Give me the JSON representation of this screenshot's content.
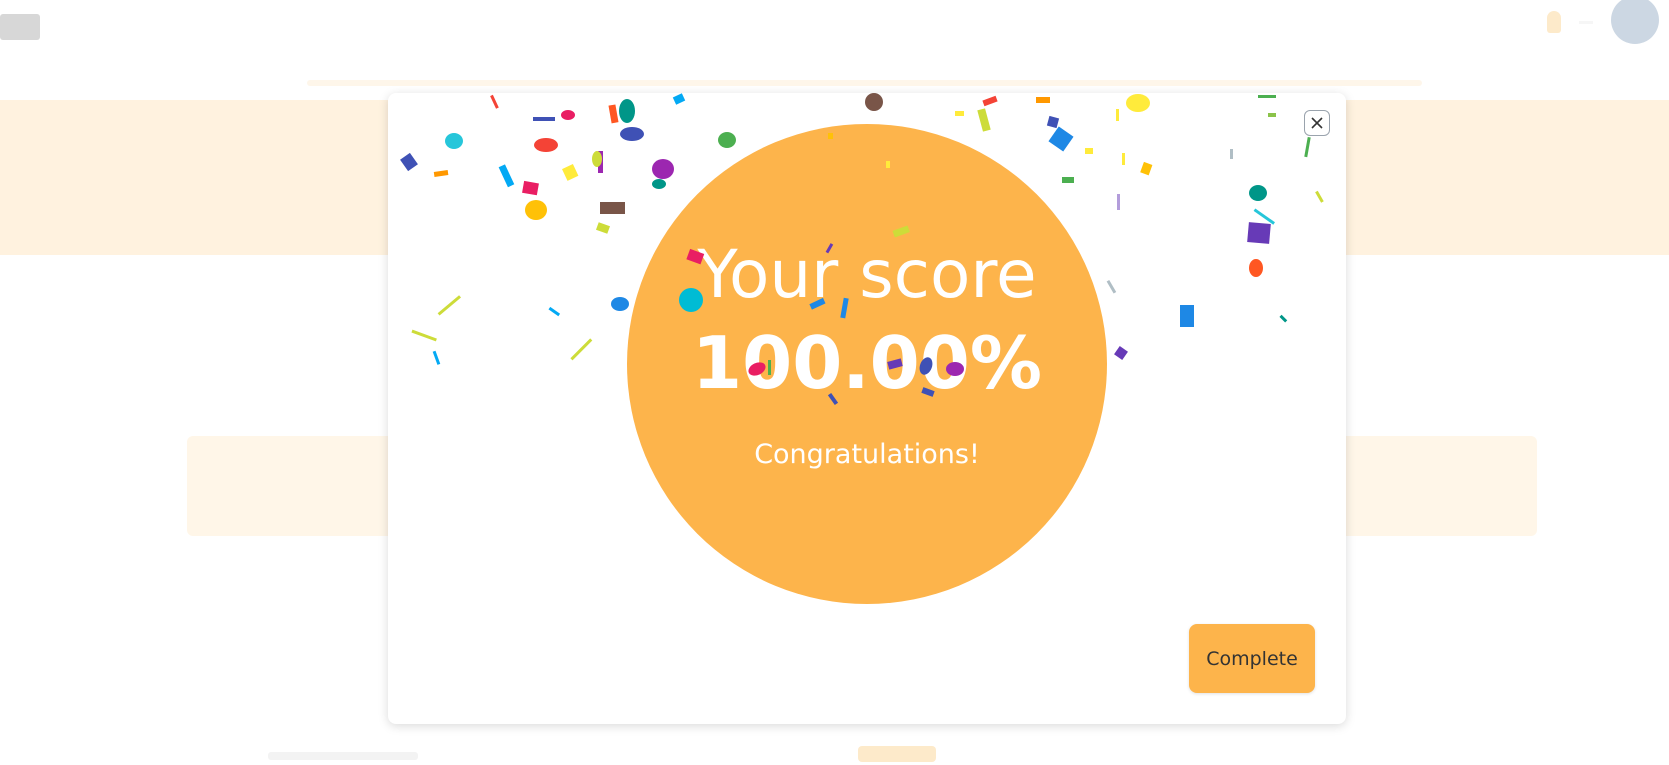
{
  "modal": {
    "score_title": "Your score",
    "score_value": "100.00%",
    "message": "Congratulations!",
    "complete_label": "Complete",
    "close_icon": "close-icon"
  },
  "colors": {
    "accent": "#fdb44b",
    "banner": "#fdc978",
    "text_on_accent": "#ffffff",
    "button_text": "#333333"
  }
}
